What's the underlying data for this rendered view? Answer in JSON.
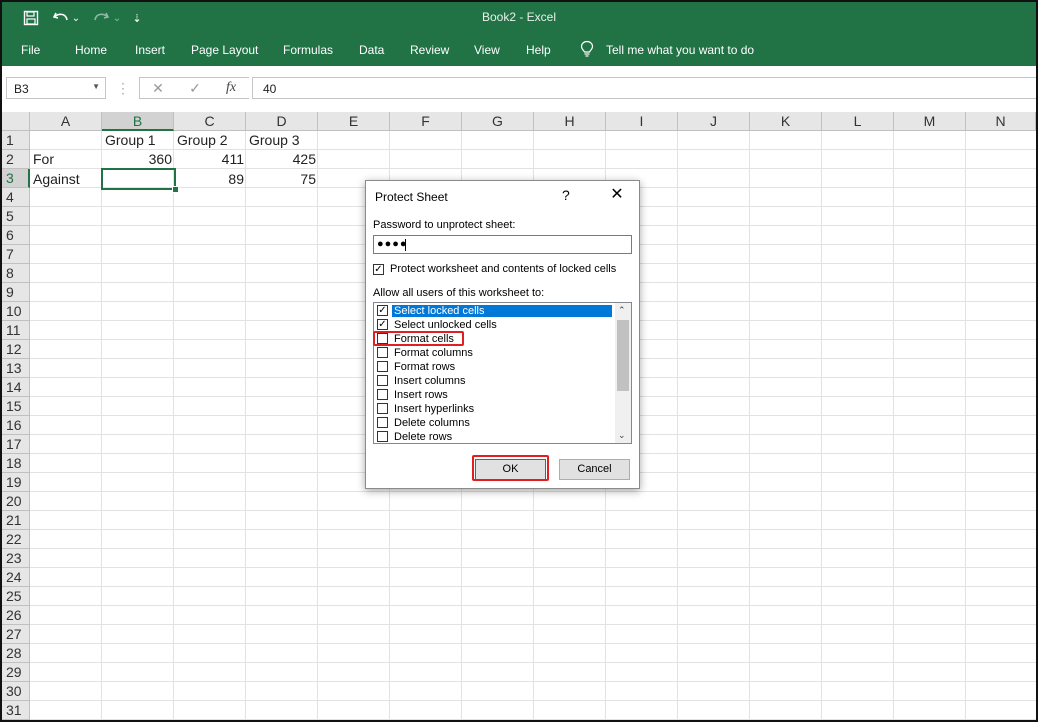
{
  "window": {
    "title": "Book2  -  Excel"
  },
  "quick_access": {
    "save": "🖫",
    "undo": "↶",
    "undo_dd": "⌄",
    "redo": "↷",
    "redo_dd": "⌄",
    "customize": "⇣"
  },
  "ribbon": {
    "tabs": [
      "File",
      "Home",
      "Insert",
      "Page Layout",
      "Formulas",
      "Data",
      "Review",
      "View",
      "Help"
    ],
    "tell_me": "Tell me what you want to do"
  },
  "formula_bar": {
    "name_box": "B3",
    "value": "40",
    "cancel": "✕",
    "enter": "✓",
    "fx": "fx",
    "separator": "⋮"
  },
  "sheet": {
    "columns": [
      "A",
      "B",
      "C",
      "D",
      "E",
      "F",
      "G",
      "H",
      "I",
      "J",
      "K",
      "L",
      "M",
      "N"
    ],
    "rows": [
      "1",
      "2",
      "3",
      "4",
      "5",
      "6",
      "7",
      "8",
      "9",
      "10",
      "11",
      "12",
      "13",
      "14",
      "15",
      "16",
      "17",
      "18",
      "19",
      "20",
      "21",
      "22",
      "23",
      "24",
      "25",
      "26",
      "27",
      "28",
      "29",
      "30",
      "31"
    ],
    "selected_cell": "B3",
    "cells": {
      "B1": "Group 1",
      "C1": "Group 2",
      "D1": "Group 3",
      "A2": "For",
      "B2": "360",
      "C2": "411",
      "D2": "425",
      "A3": "Against",
      "C3": "89",
      "D3": "75"
    }
  },
  "dialog": {
    "title": "Protect Sheet",
    "help": "?",
    "close": "✕",
    "password_label": "Password to unprotect sheet:",
    "password_value": "●●●●",
    "protect_checkbox_label": "Protect worksheet and contents of locked cells",
    "protect_checked": true,
    "allow_label": "Allow all users of this worksheet to:",
    "options": [
      {
        "label": "Select locked cells",
        "checked": true,
        "selected": true
      },
      {
        "label": "Select unlocked cells",
        "checked": true,
        "selected": false
      },
      {
        "label": "Format cells",
        "checked": false,
        "selected": false
      },
      {
        "label": "Format columns",
        "checked": false,
        "selected": false
      },
      {
        "label": "Format rows",
        "checked": false,
        "selected": false
      },
      {
        "label": "Insert columns",
        "checked": false,
        "selected": false
      },
      {
        "label": "Insert rows",
        "checked": false,
        "selected": false
      },
      {
        "label": "Insert hyperlinks",
        "checked": false,
        "selected": false
      },
      {
        "label": "Delete columns",
        "checked": false,
        "selected": false
      },
      {
        "label": "Delete rows",
        "checked": false,
        "selected": false
      }
    ],
    "scroll_up": "⌃",
    "scroll_down": "⌄",
    "ok_label": "OK",
    "cancel_label": "Cancel"
  },
  "colors": {
    "excel_green": "#217346",
    "highlight_red": "#e02020",
    "selection_blue": "#0078d7"
  }
}
